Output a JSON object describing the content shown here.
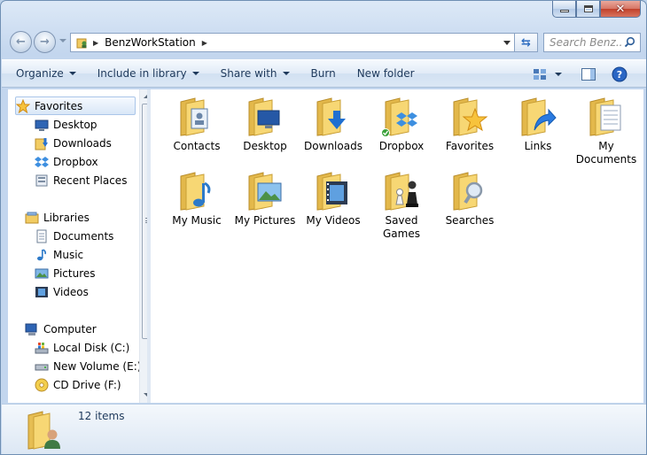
{
  "window": {
    "caption_buttons": [
      "minimize-icon",
      "maximize-icon",
      "close-icon"
    ]
  },
  "navigation": {
    "back_icon": "back-arrow-icon",
    "forward_icon": "forward-arrow-icon",
    "address_path": "BenzWorkStation",
    "search_placeholder": "Search Benz..."
  },
  "toolbar": {
    "organize": "Organize",
    "include_in_library": "Include in library",
    "share_with": "Share with",
    "burn": "Burn",
    "new_folder": "New folder"
  },
  "nav_pane": {
    "favorites": {
      "label": "Favorites",
      "items": [
        "Desktop",
        "Downloads",
        "Dropbox",
        "Recent Places"
      ]
    },
    "libraries": {
      "label": "Libraries",
      "items": [
        "Documents",
        "Music",
        "Pictures",
        "Videos"
      ]
    },
    "computer": {
      "label": "Computer",
      "items": [
        "Local Disk (C:)",
        "New Volume (E:)",
        "CD Drive (F:)"
      ]
    }
  },
  "content": {
    "items": [
      {
        "label": "Contacts",
        "icon": "contacts-folder-icon"
      },
      {
        "label": "Desktop",
        "icon": "desktop-folder-icon"
      },
      {
        "label": "Downloads",
        "icon": "downloads-folder-icon"
      },
      {
        "label": "Dropbox",
        "icon": "dropbox-folder-icon"
      },
      {
        "label": "Favorites",
        "icon": "favorites-folder-icon"
      },
      {
        "label": "Links",
        "icon": "links-folder-icon"
      },
      {
        "label": "My Documents",
        "icon": "documents-folder-icon"
      },
      {
        "label": "My Music",
        "icon": "music-folder-icon"
      },
      {
        "label": "My Pictures",
        "icon": "pictures-folder-icon"
      },
      {
        "label": "My Videos",
        "icon": "videos-folder-icon"
      },
      {
        "label": "Saved Games",
        "icon": "saved-games-folder-icon"
      },
      {
        "label": "Searches",
        "icon": "searches-folder-icon"
      }
    ]
  },
  "status": {
    "item_count": "12 items"
  },
  "colors": {
    "accent": "#1e395b",
    "folder": "#f3cf6a",
    "selection": "#d9e7f7"
  }
}
